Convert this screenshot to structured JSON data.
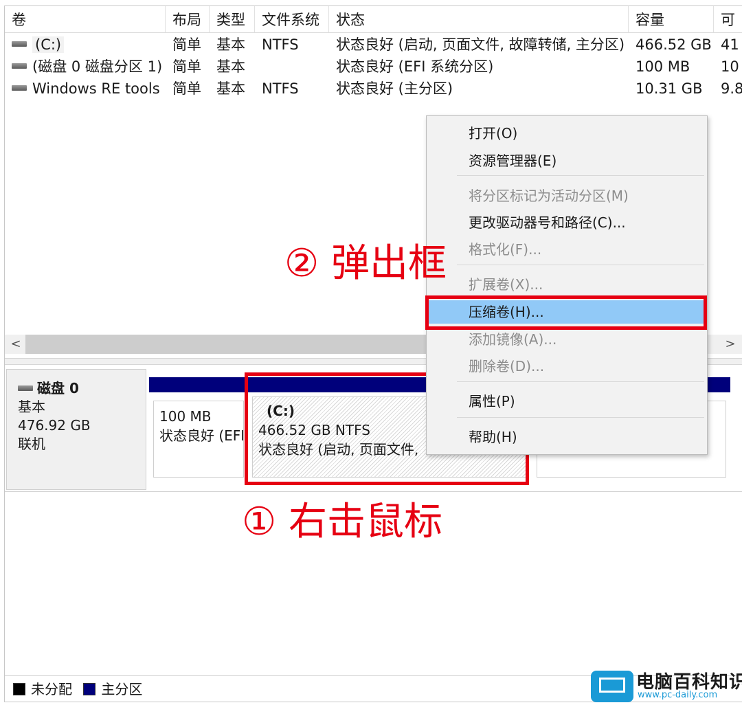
{
  "volume_table": {
    "columns": [
      "卷",
      "布局",
      "类型",
      "文件系统",
      "状态",
      "容量",
      "可"
    ],
    "rows": [
      {
        "name": "(C:)",
        "layout": "简单",
        "type": "基本",
        "fs": "NTFS",
        "status": "状态良好 (启动, 页面文件, 故障转储, 主分区)",
        "capacity": "466.52 GB",
        "free": "41"
      },
      {
        "name": "(磁盘 0 磁盘分区 1)",
        "layout": "简单",
        "type": "基本",
        "fs": "",
        "status": "状态良好 (EFI 系统分区)",
        "capacity": "100 MB",
        "free": "10"
      },
      {
        "name": "Windows RE tools",
        "layout": "简单",
        "type": "基本",
        "fs": "NTFS",
        "status": "状态良好 (主分区)",
        "capacity": "10.31 GB",
        "free": "9.8"
      }
    ]
  },
  "scroll": {
    "left_arrow": "<",
    "right_arrow": ">"
  },
  "disk": {
    "name": "磁盘 0",
    "type": "基本",
    "size": "476.92 GB",
    "status": "联机",
    "partitions": [
      {
        "line1": "100 MB",
        "line2": "状态良好 (EFI"
      },
      {
        "label": "(C:)",
        "line1": "466.52 GB NTFS",
        "line2": "状态良好 (启动, 页面文件,"
      }
    ]
  },
  "legend": {
    "unallocated": "未分配",
    "primary": "主分区"
  },
  "context_menu": {
    "items": [
      {
        "label": "打开(O)",
        "disabled": false
      },
      {
        "label": "资源管理器(E)",
        "disabled": false
      },
      {
        "label": "将分区标记为活动分区(M)",
        "disabled": true
      },
      {
        "label": "更改驱动器号和路径(C)...",
        "disabled": false
      },
      {
        "label": "格式化(F)...",
        "disabled": true
      },
      {
        "label": "扩展卷(X)...",
        "disabled": true
      },
      {
        "label": "压缩卷(H)...",
        "disabled": false
      },
      {
        "label": "添加镜像(A)...",
        "disabled": true
      },
      {
        "label": "删除卷(D)...",
        "disabled": true
      },
      {
        "label": "属性(P)",
        "disabled": false
      },
      {
        "label": "帮助(H)",
        "disabled": false
      }
    ]
  },
  "annotations": {
    "step1": "① 右击鼠标",
    "step2": "② 弹出框"
  },
  "watermark": {
    "title": "电脑百科知识",
    "url": "www.pc-daily.com"
  },
  "colors": {
    "accent_red": "#e60012",
    "primary_partition": "#00007b",
    "menu_highlight": "#91c9f7",
    "unallocated": "#000000"
  },
  "icons": [
    "drive-icon",
    "disk-icon",
    "monitor-icon"
  ]
}
